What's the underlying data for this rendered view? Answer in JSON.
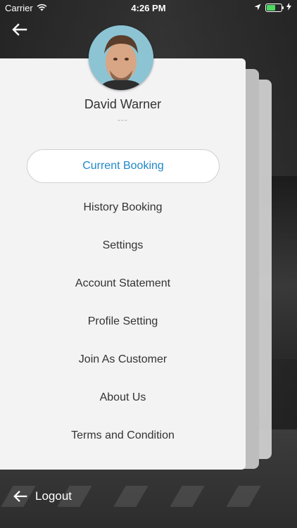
{
  "status_bar": {
    "carrier": "Carrier",
    "time": "4:26 PM"
  },
  "icons": {
    "back": "arrow-left-icon",
    "wifi": "wifi-icon",
    "location": "location-arrow-icon",
    "battery": "battery-icon",
    "charging": "charging-bolt-icon",
    "logout": "arrow-left-icon"
  },
  "profile": {
    "name": "David Warner",
    "subtitle": "---"
  },
  "menu": {
    "items": [
      {
        "label": "Current Booking",
        "active": true
      },
      {
        "label": "History Booking",
        "active": false
      },
      {
        "label": "Settings",
        "active": false
      },
      {
        "label": "Account Statement",
        "active": false
      },
      {
        "label": "Profile Setting",
        "active": false
      },
      {
        "label": "Join As Customer",
        "active": false
      },
      {
        "label": "About Us",
        "active": false
      },
      {
        "label": "Terms and Condition",
        "active": false
      }
    ]
  },
  "footer": {
    "logout_label": "Logout"
  },
  "colors": {
    "accent": "#1e88c9",
    "card": "#f4f3f4",
    "battery_fill": "#4cd964"
  }
}
